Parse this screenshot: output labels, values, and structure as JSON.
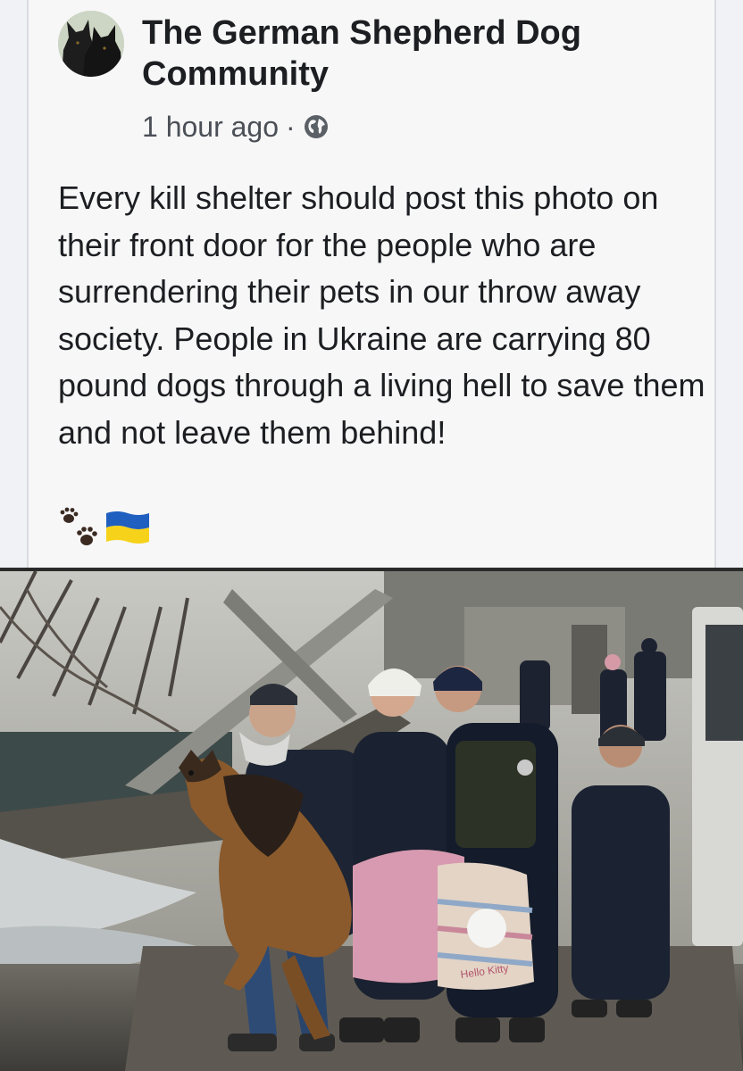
{
  "post": {
    "page_name": "The German Shepherd Dog Community",
    "time": "1 hour ago",
    "separator": "·",
    "audience_icon": "globe-icon",
    "text": "Every kill shelter should post this photo on their front door for the people who are surrendering their pets in our throw away society. People in Ukraine are carrying 80 pound dogs through a living hell to save them and not leave them behind!",
    "emojis": [
      "paw-prints-icon",
      "ukraine-flag-icon"
    ]
  },
  "photo": {
    "bag_print": "Hello Kitty"
  },
  "colors": {
    "card_bg": "#f7f7f8",
    "text": "#1c1e21",
    "meta": "#4b4f56",
    "flag_blue": "#1f5fbf",
    "flag_yellow": "#f6d21a"
  }
}
